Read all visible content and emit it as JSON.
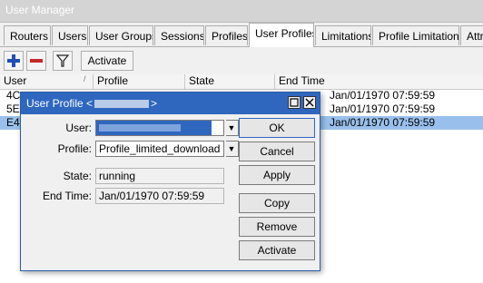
{
  "window": {
    "title": "User Manager"
  },
  "tabs": [
    {
      "label": "Routers"
    },
    {
      "label": "Users"
    },
    {
      "label": "User Groups"
    },
    {
      "label": "Sessions"
    },
    {
      "label": "Profiles"
    },
    {
      "label": "User Profiles",
      "active": true
    },
    {
      "label": "Limitations"
    },
    {
      "label": "Profile Limitations"
    },
    {
      "label": "Attrib"
    }
  ],
  "toolbar": {
    "add_icon": "plus-icon",
    "remove_icon": "minus-icon",
    "filter_icon": "filter-icon",
    "activate_label": "Activate"
  },
  "grid": {
    "columns": [
      "User",
      "Profile",
      "State",
      "End Time"
    ],
    "rows": [
      {
        "user": "4C",
        "end_time": "Jan/01/1970 07:59:59",
        "selected": false
      },
      {
        "user": "5E",
        "end_time": "Jan/01/1970 07:59:59",
        "selected": false
      },
      {
        "user": "E4",
        "end_time": "Jan/01/1970 07:59:59",
        "selected": true
      }
    ]
  },
  "dialog": {
    "title": "User Profile <",
    "title_end": ">",
    "user_label": "User:",
    "profile_label": "Profile:",
    "profile_value": "Profile_limited_download",
    "state_label": "State:",
    "state_value": "running",
    "end_time_label": "End Time:",
    "end_time_value": "Jan/01/1970 07:59:59",
    "buttons": {
      "ok": "OK",
      "cancel": "Cancel",
      "apply": "Apply",
      "copy": "Copy",
      "remove": "Remove",
      "activate": "Activate"
    }
  },
  "colors": {
    "dialog_title_bg": "#2f67bf",
    "selection": "#99c0ec",
    "add_icon": "#1f4fb3",
    "remove_icon": "#c62828"
  }
}
